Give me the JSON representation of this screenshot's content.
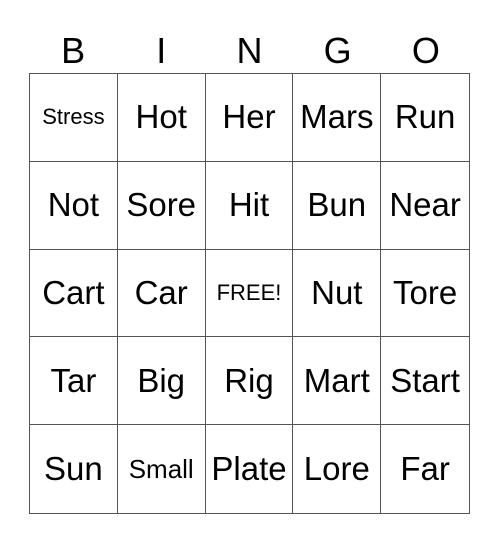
{
  "header": [
    "B",
    "I",
    "N",
    "G",
    "O"
  ],
  "cells": [
    "Stress",
    "Hot",
    "Her",
    "Mars",
    "Run",
    "Not",
    "Sore",
    "Hit",
    "Bun",
    "Near",
    "Cart",
    "Car",
    "FREE!",
    "Nut",
    "Tore",
    "Tar",
    "Big",
    "Rig",
    "Mart",
    "Start",
    "Sun",
    "Small",
    "Plate",
    "Lore",
    "Far"
  ]
}
